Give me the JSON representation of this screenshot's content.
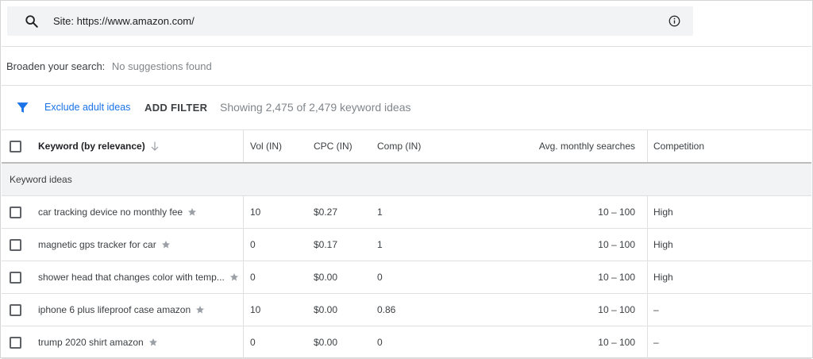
{
  "search": {
    "text": "Site: https://www.amazon.com/",
    "search_icon": "search-icon",
    "info_icon": "info-icon"
  },
  "broaden": {
    "label": "Broaden your search:",
    "value": "No suggestions found"
  },
  "filters": {
    "filter_icon": "filter-icon",
    "exclude_label": "Exclude adult ideas",
    "add_filter_label": "ADD FILTER",
    "showing_text": "Showing 2,475 of 2,479 keyword ideas"
  },
  "table": {
    "headers": {
      "keyword": "Keyword (by relevance)",
      "vol": "Vol (IN)",
      "cpc": "CPC (IN)",
      "comp": "Comp (IN)",
      "avg": "Avg. monthly searches",
      "competition": "Competition"
    },
    "group_label": "Keyword ideas",
    "rows": [
      {
        "keyword": "car tracking device no monthly fee",
        "vol": "10",
        "cpc": "$0.27",
        "comp": "1",
        "avg": "10 – 100",
        "competition": "High"
      },
      {
        "keyword": "magnetic gps tracker for car",
        "vol": "0",
        "cpc": "$0.17",
        "comp": "1",
        "avg": "10 – 100",
        "competition": "High"
      },
      {
        "keyword": "shower head that changes color with temp...",
        "vol": "0",
        "cpc": "$0.00",
        "comp": "0",
        "avg": "10 – 100",
        "competition": "High"
      },
      {
        "keyword": "iphone 6 plus lifeproof case amazon",
        "vol": "10",
        "cpc": "$0.00",
        "comp": "0.86",
        "avg": "10 – 100",
        "competition": "–"
      },
      {
        "keyword": "trump 2020 shirt amazon",
        "vol": "0",
        "cpc": "$0.00",
        "comp": "0",
        "avg": "10 – 100",
        "competition": "–"
      }
    ]
  },
  "colors": {
    "accent": "#1a73e8",
    "search_bg": "#f1f3f4",
    "group_bg": "#f1f3f4"
  }
}
